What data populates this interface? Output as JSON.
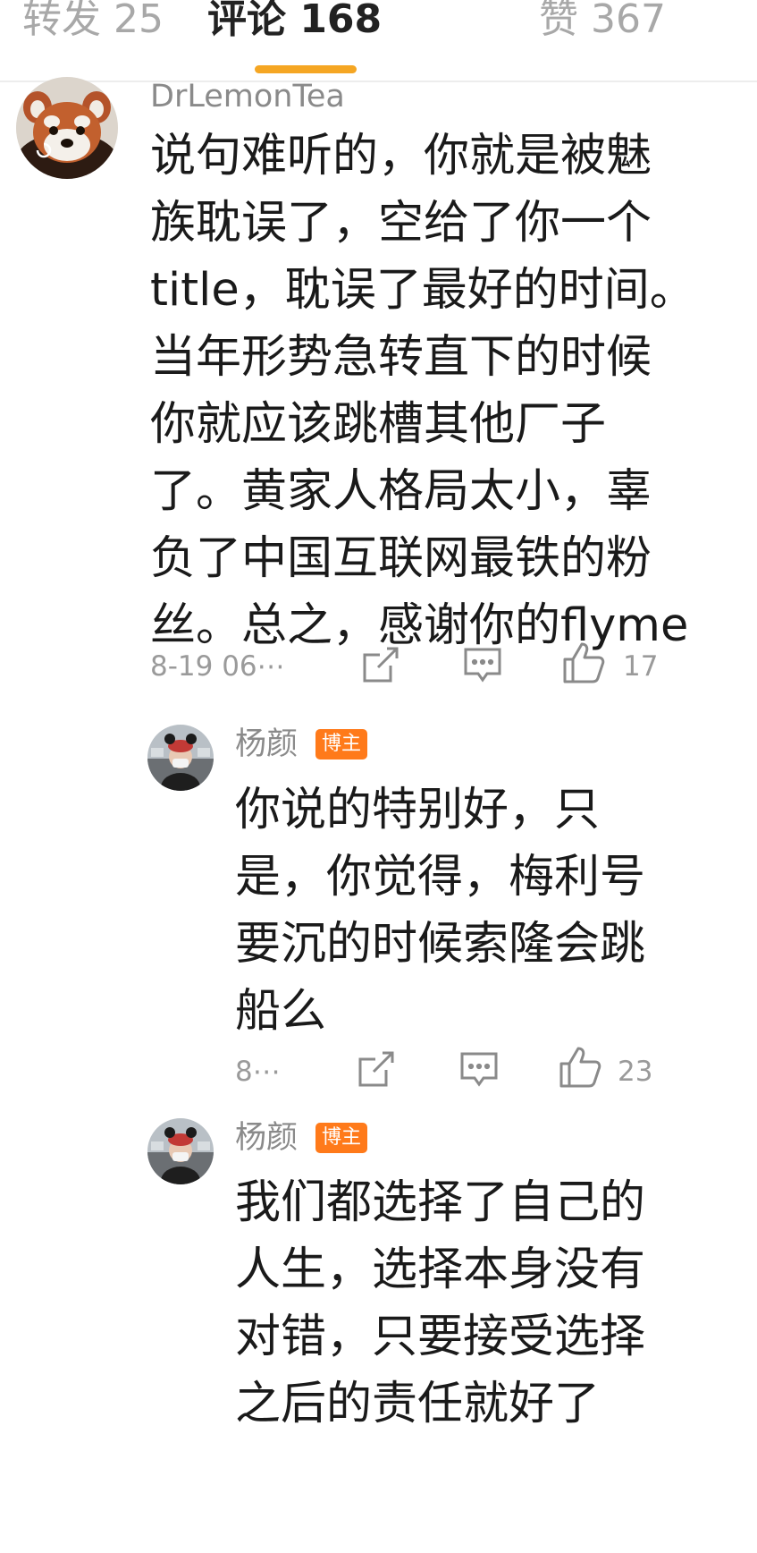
{
  "tabs": [
    {
      "label": "转发 25"
    },
    {
      "label": "评论 168"
    },
    {
      "label": "赞 367"
    }
  ],
  "comments": [
    {
      "user": "DrLemonTea",
      "text": "说句难听的，你就是被魅\n族耽误了，空给了你一个\ntitle，耽误了最好的时间。\n当年形势急转直下的时候\n你就应该跳槽其他厂子\n了。黄家人格局太小，辜\n负了中国互联网最铁的粉\n丝。总之，感谢你的flyme",
      "time": "8-19 06⋯",
      "likes": "17"
    }
  ],
  "replies": [
    {
      "user": "杨颜",
      "badge": "博主",
      "text": "你说的特别好，只\n是，你觉得，梅利号\n要沉的时候索隆会跳\n船么",
      "time": "8⋯",
      "likes": "23"
    },
    {
      "user": "杨颜",
      "badge": "博主",
      "text": "我们都选择了自己的\n人生，选择本身没有\n对错，只要接受选择\n之后的责任就好了"
    }
  ],
  "icons": {
    "share": "share-icon",
    "comment": "comment-icon",
    "like": "thumbs-up-icon"
  },
  "colors": {
    "accent": "#f5a623",
    "badge": "#ff7a1a",
    "muted": "#9a9a9a"
  }
}
